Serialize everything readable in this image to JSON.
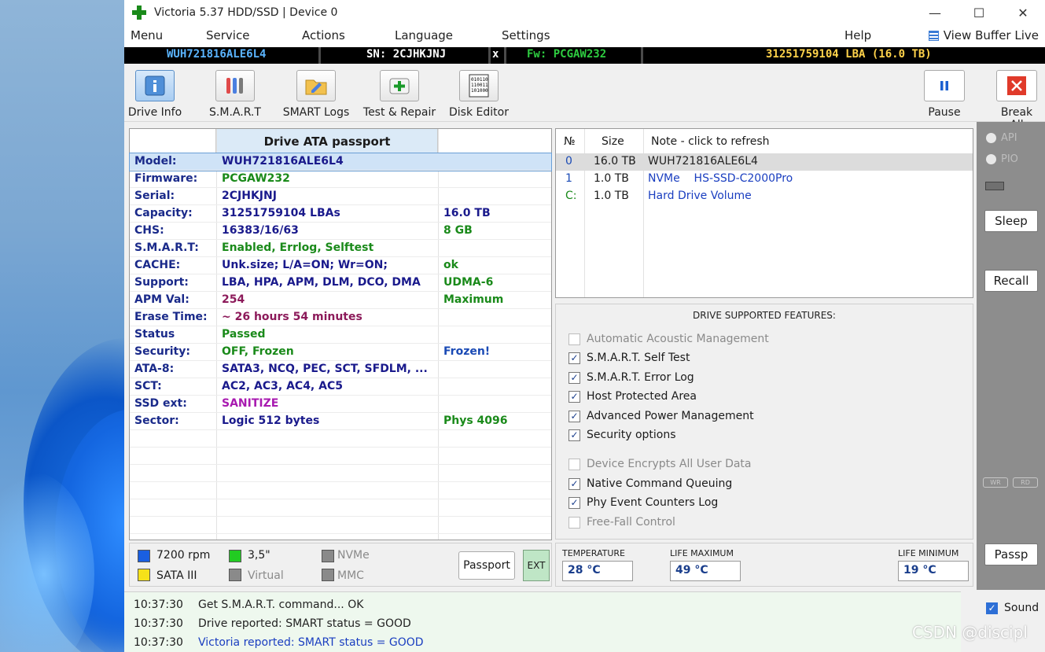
{
  "window": {
    "title": "Victoria 5.37 HDD/SSD | Device 0"
  },
  "menu": [
    "Menu",
    "Service",
    "Actions",
    "Language",
    "Settings",
    "Help"
  ],
  "view_buffer": "View Buffer Live",
  "infobar": {
    "model": "WUH721816ALE6L4",
    "serial": "SN: 2CJHKJNJ",
    "close": "x",
    "firmware": "Fw: PCGAW232",
    "capacity": "31251759104 LBA (16.0 TB)"
  },
  "toolbar": {
    "drive_info": "Drive Info",
    "smart": "S.M.A.R.T",
    "smart_logs": "SMART Logs",
    "test_repair": "Test & Repair",
    "disk_editor": "Disk Editor",
    "pause": "Pause",
    "break_all": "Break All"
  },
  "passport": {
    "title": "Drive ATA passport",
    "rows": [
      {
        "label": "Model:",
        "value": "WUH721816ALE6L4",
        "extra": "",
        "value_color": "#1a1a8c",
        "extra_color": ""
      },
      {
        "label": "Firmware:",
        "value": "PCGAW232",
        "extra": "",
        "value_color": "#1a8a1a",
        "extra_color": ""
      },
      {
        "label": "Serial:",
        "value": "2CJHKJNJ",
        "extra": "",
        "value_color": "#1a1a8c",
        "extra_color": ""
      },
      {
        "label": "Capacity:",
        "value": "31251759104 LBAs",
        "extra": "16.0 TB",
        "value_color": "#1a1a8c",
        "extra_color": "#1a1a8c"
      },
      {
        "label": "CHS:",
        "value": "16383/16/63",
        "extra": "8 GB",
        "value_color": "#1a1a8c",
        "extra_color": "#1a8a1a"
      },
      {
        "label": "S.M.A.R.T:",
        "value": "Enabled, Errlog, Selftest",
        "extra": "",
        "value_color": "#1a8a1a",
        "extra_color": ""
      },
      {
        "label": "CACHE:",
        "value": "Unk.size; L/A=ON; Wr=ON;",
        "extra": "ok",
        "value_color": "#1a1a8c",
        "extra_color": "#1a8a1a"
      },
      {
        "label": "Support:",
        "value": "LBA, HPA, APM, DLM, DCO, DMA",
        "extra": "UDMA-6",
        "value_color": "#1a1a8c",
        "extra_color": "#1a8a1a"
      },
      {
        "label": "APM Val:",
        "value": "254",
        "extra": "Maximum",
        "value_color": "#8c1a5a",
        "extra_color": "#1a8a1a"
      },
      {
        "label": "Erase Time:",
        "value": "~ 26 hours 54 minutes",
        "extra": "",
        "value_color": "#8c1a5a",
        "extra_color": ""
      },
      {
        "label": "Status",
        "value": "Passed",
        "extra": "",
        "value_color": "#1a8a1a",
        "extra_color": ""
      },
      {
        "label": "Security:",
        "value": "OFF, Frozen",
        "extra": "Frozen!",
        "value_color": "#1a8a1a",
        "extra_color": "#1a4ab5"
      },
      {
        "label": "ATA-8:",
        "value": "SATA3, NCQ, PEC, SCT, SFDLM, ...",
        "extra": "",
        "value_color": "#1a1a8c",
        "extra_color": ""
      },
      {
        "label": "SCT:",
        "value": "AC2, AC3, AC4, AC5",
        "extra": "",
        "value_color": "#1a1a8c",
        "extra_color": ""
      },
      {
        "label": "SSD ext:",
        "value": "SANITIZE",
        "extra": "",
        "value_color": "#a81ab0",
        "extra_color": ""
      },
      {
        "label": "Sector:",
        "value": "Logic 512 bytes",
        "extra": "Phys 4096",
        "value_color": "#1a1a8c",
        "extra_color": "#1a8a1a"
      }
    ]
  },
  "indicators": {
    "rpm": "7200 rpm",
    "form": "3,5\"",
    "nvme": "NVMe",
    "sata": "SATA III",
    "virtual": "Virtual",
    "mmc": "MMC",
    "passport_btn": "Passport",
    "ext_btn": "EXT"
  },
  "drives": {
    "headers": {
      "num": "№",
      "size": "Size",
      "note": "Note - click to refresh"
    },
    "rows": [
      {
        "num": "0",
        "size": "16.0 TB",
        "note": "WUH721816ALE6L4",
        "num_color": "#1a4ab5",
        "note_color": "#222"
      },
      {
        "num": "1",
        "size": "1.0 TB",
        "note": "NVMe    HS-SSD-C2000Pro",
        "num_color": "#1a4ab5",
        "note_color": "#1a3ec0"
      },
      {
        "num": "C:",
        "size": "1.0 TB",
        "note": "Hard Drive Volume",
        "num_color": "#1a8a1a",
        "note_color": "#1a3ec0"
      }
    ]
  },
  "features": {
    "title": "DRIVE SUPPORTED FEATURES:",
    "items": [
      {
        "label": "Automatic Acoustic Management",
        "checked": false
      },
      {
        "label": "S.M.A.R.T. Self Test",
        "checked": true
      },
      {
        "label": "S.M.A.R.T. Error Log",
        "checked": true
      },
      {
        "label": "Host Protected Area",
        "checked": true
      },
      {
        "label": "Advanced Power Management",
        "checked": true
      },
      {
        "label": "Security options",
        "checked": true
      },
      {
        "label": "Device Encrypts All User Data",
        "checked": false
      },
      {
        "label": "Native Command Queuing",
        "checked": true
      },
      {
        "label": "Phy Event Counters Log",
        "checked": true
      },
      {
        "label": "Free-Fall Control",
        "checked": false
      }
    ]
  },
  "temps": {
    "temp_label": "TEMPERATURE",
    "temp": "28 °C",
    "lifemax_label": "LIFE MAXIMUM",
    "lifemax": "49 °C",
    "lifemin_label": "LIFE MINIMUM",
    "lifemin": "19 °C"
  },
  "side": {
    "api": "API",
    "pio": "PIO",
    "sleep": "Sleep",
    "recall": "Recall",
    "wr": "WR",
    "rd": "RD",
    "passp": "Passp"
  },
  "log": [
    {
      "time": "10:37:30",
      "msg": "Get S.M.A.R.T. command... OK",
      "color": "#222"
    },
    {
      "time": "10:37:30",
      "msg": "Drive reported: SMART status = GOOD",
      "color": "#222"
    },
    {
      "time": "10:37:30",
      "msg": "Victoria reported: SMART status = GOOD",
      "color": "#1a3ec0"
    }
  ],
  "sound": "Sound",
  "watermark": "CSDN @discipl",
  "colors": {
    "model": "#5ab4ff",
    "serial": "#ffffff",
    "firmware": "#2ecc40",
    "capacity": "#ffd24a"
  }
}
